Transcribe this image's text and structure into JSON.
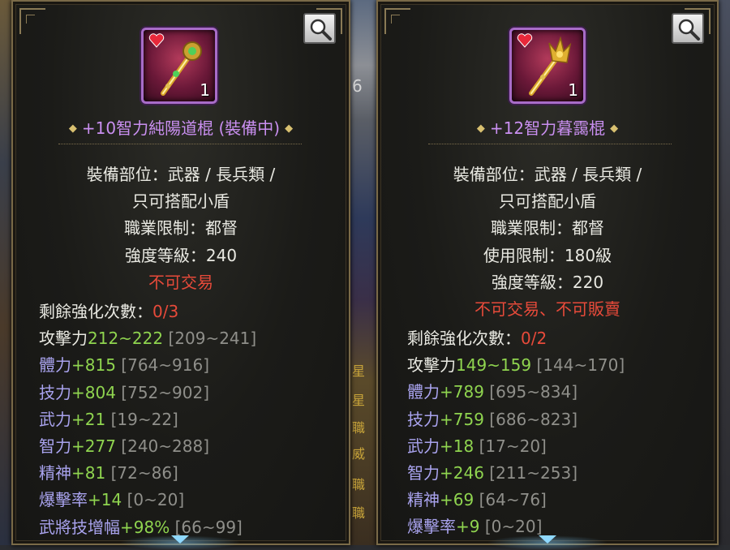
{
  "colors": {
    "title": "#c98ff0",
    "normal_text": "#e9e9e2",
    "restriction": "#e74a3a",
    "stat_value": "#8fd44f",
    "stat_range": "#8f8f8a",
    "stat_label_blue": "#a9a3ee",
    "frame_border": "#7a6a48",
    "item_frame": "#a86cc8"
  },
  "background": {
    "chat_fragments": [
      "6",
      "星",
      "星",
      "職",
      "威",
      "職",
      "職"
    ]
  },
  "left_panel": {
    "icon": "scepter-icon",
    "quantity": "1",
    "title": "+10智力純陽道棍 (裝備中)",
    "info": {
      "equip_slot_1": "裝備部位：武器 / 長兵類 /",
      "equip_slot_2": "只可搭配小盾",
      "job_limit": "職業限制：都督",
      "strength_level": "強度等級：240",
      "trade_limit": "不可交易"
    },
    "enhance": {
      "label": "剩餘強化次數：",
      "value": "0/3"
    },
    "attack": {
      "label": "攻擊力",
      "value": "212~222",
      "range": "[209~241]"
    },
    "stats": [
      {
        "label": "體力",
        "value": "+815",
        "range": "[764~916]"
      },
      {
        "label": "技力",
        "value": "+804",
        "range": "[752~902]"
      },
      {
        "label": "武力",
        "value": "+21",
        "range": "[19~22]"
      },
      {
        "label": "智力",
        "value": "+277",
        "range": "[240~288]"
      },
      {
        "label": "精神",
        "value": "+81",
        "range": "[72~86]"
      },
      {
        "label": "爆擊率",
        "value": "+14",
        "range": "[0~20]"
      },
      {
        "label": "武將技增幅",
        "value": "+98%",
        "range": "[66~99]"
      }
    ]
  },
  "right_panel": {
    "icon": "scepter-icon",
    "quantity": "1",
    "title": "+12智力暮靄棍",
    "info": {
      "equip_slot_1": "裝備部位：武器 / 長兵類 /",
      "equip_slot_2": "只可搭配小盾",
      "job_limit": "職業限制：都督",
      "use_limit": "使用限制：180級",
      "strength_level": "強度等級：220",
      "trade_limit": "不可交易、不可販賣"
    },
    "enhance": {
      "label": "剩餘強化次數：",
      "value": "0/2"
    },
    "attack": {
      "label": "攻擊力",
      "value": "149~159",
      "range": "[144~170]"
    },
    "stats": [
      {
        "label": "體力",
        "value": "+789",
        "range": "[695~834]"
      },
      {
        "label": "技力",
        "value": "+759",
        "range": "[686~823]"
      },
      {
        "label": "武力",
        "value": "+18",
        "range": "[17~20]"
      },
      {
        "label": "智力",
        "value": "+246",
        "range": "[211~253]"
      },
      {
        "label": "精神",
        "value": "+69",
        "range": "[64~76]"
      },
      {
        "label": "爆擊率",
        "value": "+9",
        "range": "[0~20]"
      }
    ]
  }
}
